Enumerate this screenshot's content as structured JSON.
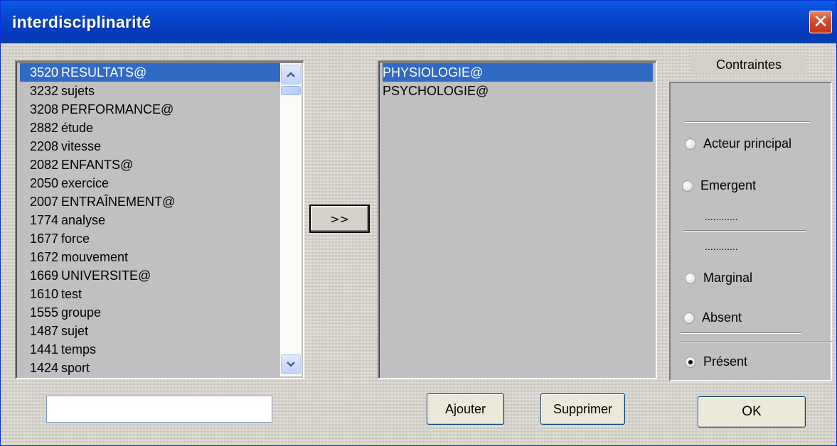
{
  "window": {
    "title": "interdisciplinarité",
    "close_glyph": "✕"
  },
  "left_list": {
    "items": [
      {
        "count": "3520",
        "label": "RESULTATS@",
        "selected": true
      },
      {
        "count": "3232",
        "label": "sujets"
      },
      {
        "count": "3208",
        "label": "PERFORMANCE@"
      },
      {
        "count": "2882",
        "label": "étude"
      },
      {
        "count": "2208",
        "label": "vitesse"
      },
      {
        "count": "2082",
        "label": "ENFANTS@"
      },
      {
        "count": "2050",
        "label": "exercice"
      },
      {
        "count": "2007",
        "label": "ENTRAÎNEMENT@"
      },
      {
        "count": "1774",
        "label": "analyse"
      },
      {
        "count": "1677",
        "label": "force"
      },
      {
        "count": "1672",
        "label": "mouvement"
      },
      {
        "count": "1669",
        "label": "UNIVERSITE@"
      },
      {
        "count": "1610",
        "label": "test"
      },
      {
        "count": "1555",
        "label": "groupe"
      },
      {
        "count": "1487",
        "label": "sujet"
      },
      {
        "count": "1441",
        "label": "temps"
      },
      {
        "count": "1424",
        "label": "sport"
      }
    ],
    "scroll_up_icon": "scroll-up-arrow-icon",
    "scroll_down_icon": "scroll-down-arrow-icon"
  },
  "move_button": {
    "label": ">>"
  },
  "right_list": {
    "items": [
      {
        "label": "PHYSIOLOGIE@",
        "selected": true
      },
      {
        "label": "PSYCHOLOGIE@"
      }
    ]
  },
  "search": {
    "value": ""
  },
  "actions": {
    "add_label": "Ajouter",
    "remove_label": "Supprimer",
    "ok_label": "OK"
  },
  "constraints": {
    "title": "Contraintes",
    "options": [
      {
        "label": "Acteur principal",
        "checked": false
      },
      {
        "label": "Emergent",
        "checked": false
      },
      {
        "label": "Marginal",
        "checked": false
      },
      {
        "label": "Absent",
        "checked": false
      },
      {
        "label": "Présent",
        "checked": true
      }
    ],
    "dots_1": "............",
    "dots_2": "............"
  },
  "colors": {
    "selection": "#316ac5",
    "titlebar": "#0642c8",
    "close": "#d7492c"
  }
}
